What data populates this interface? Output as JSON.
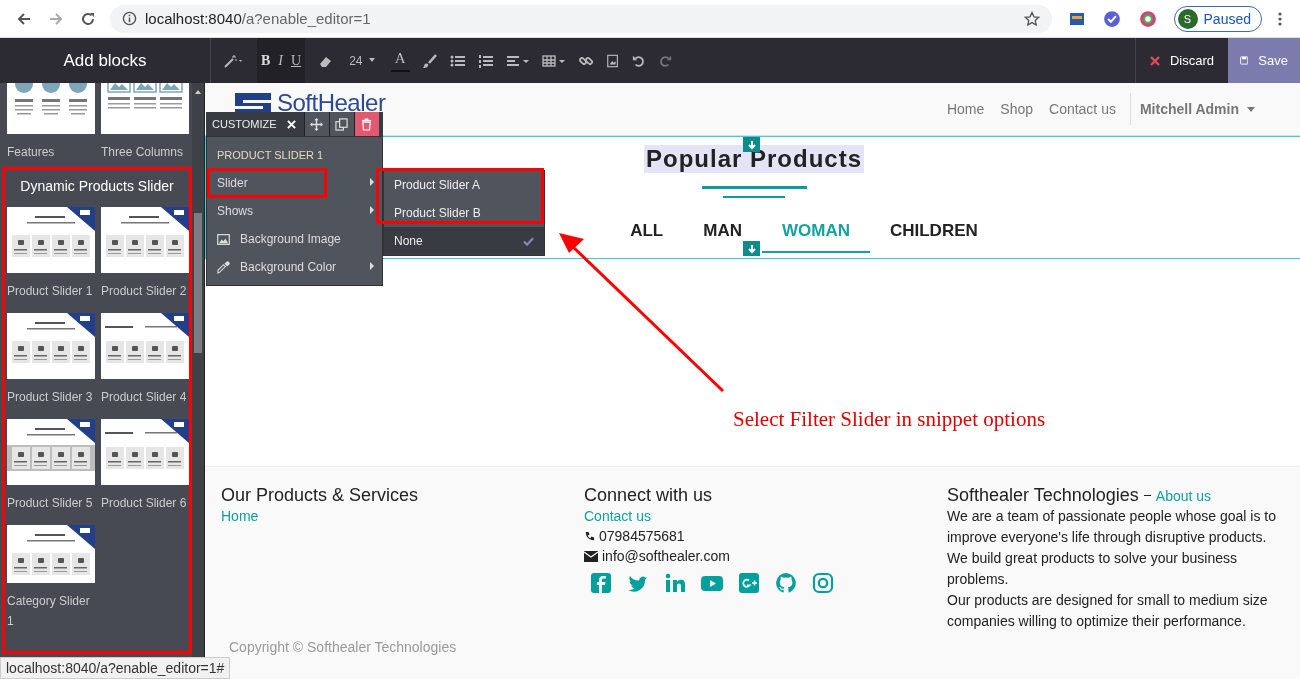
{
  "browser": {
    "url_host": "localhost:8040",
    "url_path": "/a?enable_editor=1",
    "profile_initial": "S",
    "profile_status": "Paused"
  },
  "editor_toolbar": {
    "title": "Add blocks",
    "format_buttons": [
      "B",
      "I",
      "U"
    ],
    "font_size": "24",
    "color_button": "A",
    "discard": "Discard",
    "save": "Save"
  },
  "sidebar": {
    "top_blocks": [
      {
        "label": "Features",
        "kind": "features"
      },
      {
        "label": "Three Columns",
        "kind": "columns"
      }
    ],
    "group": {
      "title": "Dynamic Products Slider",
      "highlighted": true,
      "blocks": [
        {
          "label": "Product Slider 1",
          "kind": "slider"
        },
        {
          "label": "Product Slider 2",
          "kind": "slider"
        },
        {
          "label": "Product Slider 3",
          "kind": "slider"
        },
        {
          "label": "Product Slider 4",
          "kind": "slider-wide"
        },
        {
          "label": "Product Slider 5",
          "kind": "slider-band"
        },
        {
          "label": "Product Slider 6",
          "kind": "slider-wide"
        },
        {
          "label": "Category Slider 1",
          "kind": "slider"
        }
      ]
    }
  },
  "site_header": {
    "logo": "SoftHealer",
    "nav": [
      "Home",
      "Shop",
      "Contact us"
    ],
    "user": "Mitchell Admin"
  },
  "section": {
    "title": "Popular Products",
    "tabs": [
      {
        "label": "ALL",
        "selected": false
      },
      {
        "label": "MAN",
        "selected": false
      },
      {
        "label": "WOMAN",
        "selected": true
      },
      {
        "label": "CHILDREN",
        "selected": false
      }
    ]
  },
  "customize": {
    "header": "CUSTOMIZE",
    "title": "PRODUCT SLIDER 1",
    "items": [
      {
        "label": "Slider",
        "kind": "submenu",
        "highlighted": true
      },
      {
        "label": "Shows",
        "kind": "submenu",
        "highlighted": false
      },
      {
        "label": "Background Image",
        "kind": "image",
        "highlighted": false
      },
      {
        "label": "Background Color",
        "kind": "color",
        "highlighted": false
      }
    ],
    "submenu": {
      "highlighted": true,
      "options": [
        {
          "label": "Product Slider A",
          "selected": false
        },
        {
          "label": "Product Slider B",
          "selected": false
        },
        {
          "label": "None",
          "selected": true
        }
      ]
    }
  },
  "annotation": {
    "text": "Select Filter Slider in snippet options"
  },
  "footer": {
    "columns": [
      {
        "title": "Our Products & Services",
        "link": "Home"
      },
      {
        "title": "Connect with us",
        "link": "Contact us",
        "phone": "07984575681",
        "email": "info@softhealer.com"
      },
      {
        "title": "Softhealer Technologies",
        "title_link": "About us",
        "paragraphs": [
          "We are a team of passionate people whose goal is to improve everyone's life through disruptive products. We build great products to solve your business problems.",
          "Our products are designed for small to medium size companies willing to optimize their performance."
        ]
      }
    ],
    "copyright": "Copyright © Softhealer Technologies"
  },
  "status_tooltip": "localhost:8040/a?enable_editor=1#"
}
